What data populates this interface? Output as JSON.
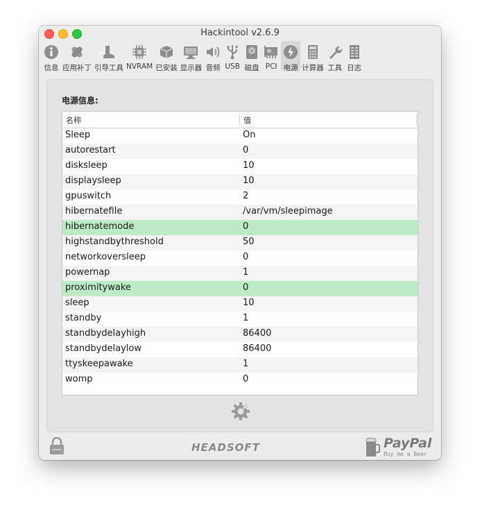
{
  "window": {
    "title": "Hackintool v2.6.9"
  },
  "toolbar": {
    "items": [
      {
        "label": "信息",
        "icon": "info-icon"
      },
      {
        "label": "应用补丁",
        "icon": "bandage-icon"
      },
      {
        "label": "引导工具",
        "icon": "boot-icon"
      },
      {
        "label": "NVRAM",
        "icon": "chip-icon"
      },
      {
        "label": "已安装",
        "icon": "package-icon"
      },
      {
        "label": "显示器",
        "icon": "monitor-icon"
      },
      {
        "label": "音频",
        "icon": "speaker-icon"
      },
      {
        "label": "USB",
        "icon": "usb-icon"
      },
      {
        "label": "磁盘",
        "icon": "disk-icon"
      },
      {
        "label": "PCI",
        "icon": "pci-card-icon"
      },
      {
        "label": "电源",
        "icon": "power-icon",
        "selected": true
      },
      {
        "label": "计算器",
        "icon": "calculator-icon"
      },
      {
        "label": "工具",
        "icon": "wrench-icon"
      },
      {
        "label": "日志",
        "icon": "log-icon"
      }
    ]
  },
  "power": {
    "section_title": "电源信息:",
    "columns": {
      "name": "名称",
      "value": "值"
    },
    "rows": [
      {
        "name": "Sleep",
        "value": "On"
      },
      {
        "name": "autorestart",
        "value": "0"
      },
      {
        "name": "disksleep",
        "value": "10"
      },
      {
        "name": "displaysleep",
        "value": "10"
      },
      {
        "name": "gpuswitch",
        "value": "2"
      },
      {
        "name": "hibernatefile",
        "value": "/var/vm/sleepimage"
      },
      {
        "name": "hibernatemode",
        "value": "0",
        "highlight": true
      },
      {
        "name": "highstandbythreshold",
        "value": "50"
      },
      {
        "name": "networkoversleep",
        "value": "0"
      },
      {
        "name": "powernap",
        "value": "1"
      },
      {
        "name": "proximitywake",
        "value": "0",
        "highlight": true
      },
      {
        "name": "sleep",
        "value": "10"
      },
      {
        "name": "standby",
        "value": "1"
      },
      {
        "name": "standbydelayhigh",
        "value": "86400"
      },
      {
        "name": "standbydelaylow",
        "value": "86400"
      },
      {
        "name": "ttyskeepawake",
        "value": "1"
      },
      {
        "name": "womp",
        "value": "0"
      }
    ],
    "highlight_color": "#bdeac7",
    "fix_button_icon": "gear-fix-icon"
  },
  "footer": {
    "lock_icon": "lock-icon",
    "brand": "HEADSOFT",
    "paypal_title": "PayPal",
    "paypal_subtitle": "Buy me a Beer"
  }
}
